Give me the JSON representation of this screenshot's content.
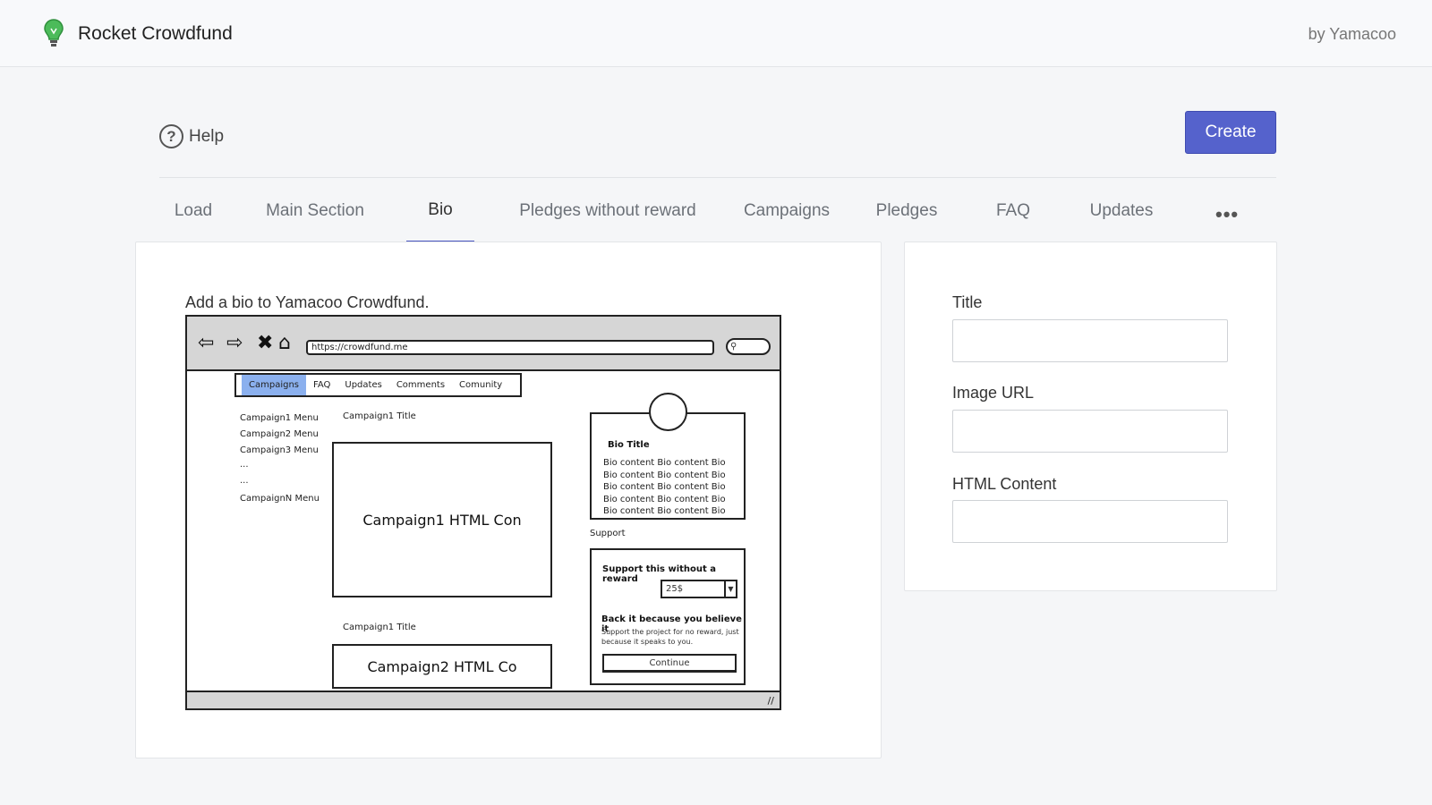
{
  "header": {
    "app_title": "Rocket Crowdfund",
    "byline": "by Yamacoo",
    "logo_icon": "lightbulb-icon"
  },
  "toolbar": {
    "help_label": "Help",
    "help_icon": "question-circle-icon",
    "create_label": "Create"
  },
  "tabs": [
    {
      "label": "Load",
      "active": false
    },
    {
      "label": "Main Section",
      "active": false
    },
    {
      "label": "Bio",
      "active": true
    },
    {
      "label": "Pledges without reward",
      "active": false
    },
    {
      "label": "Campaigns",
      "active": false
    },
    {
      "label": "Pledges",
      "active": false
    },
    {
      "label": "FAQ",
      "active": false
    },
    {
      "label": "Updates",
      "active": false
    }
  ],
  "more_tabs_glyph": "•••",
  "main": {
    "intro": "Add a bio to Yamacoo Crowdfund.",
    "wireframe": {
      "url": "https://crowdfund.me",
      "nav_glyphs": [
        "⇦",
        "⇨",
        "✖",
        "⌂"
      ],
      "search_glyph": "🔍",
      "tabs": [
        "Campaigns",
        "FAQ",
        "Updates",
        "Comments",
        "Comunity"
      ],
      "menu": [
        "Campaign1 Menu",
        "Campaign2 Menu",
        "Campaign3 Menu",
        "...",
        "...",
        "CampaignN Menu"
      ],
      "campaign_title_1": "Campaign1 Title",
      "campaign_box_1": "Campaign1 HTML Con",
      "campaign_title_2": "Campaign1 Title",
      "campaign_box_2": "Campaign2 HTML Co",
      "bio_title": "Bio Title",
      "bio_content": "Bio content Bio content Bio Bio content Bio content Bio Bio content Bio content Bio Bio content Bio content Bio Bio content Bio content Bio",
      "support_label": "Support",
      "support_heading": "Support this without a reward",
      "support_amount": "25$",
      "back_heading": "Back it because you believe it",
      "back_desc": "Support the project for no reward, just because it speaks to you.",
      "continue_label": "Continue",
      "resize_glyph": "//"
    }
  },
  "form": {
    "title_label": "Title",
    "title_value": "",
    "image_label": "Image URL",
    "image_value": "",
    "html_label": "HTML Content",
    "html_value": ""
  },
  "colors": {
    "accent": "#5562cc",
    "active_tab_underline": "#4a56c0",
    "logo_green": "#4cbb5a"
  }
}
